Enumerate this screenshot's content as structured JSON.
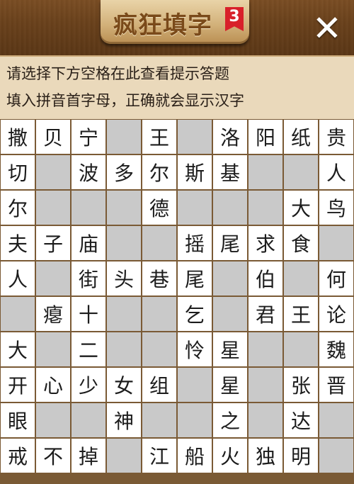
{
  "header": {
    "title": "疯狂填字",
    "level_badge": "3",
    "close_icon": "close-x-icon",
    "close_symbol": "✕"
  },
  "hints": {
    "line1": "请选择下方空格在此查看提示答题",
    "line2": "填入拼音首字母，正确就会显示汉字"
  },
  "colors": {
    "wood": "#6a411b",
    "hint_bg": "#ead9bb",
    "cell_white": "#ffffff",
    "cell_gray": "#c9c9c9",
    "badge": "#d8202a"
  },
  "grid": {
    "rows": [
      [
        "撒",
        "贝",
        "宁",
        "#",
        "王",
        "#",
        "洛",
        "阳",
        "纸",
        "贵"
      ],
      [
        "切",
        "#",
        "波",
        "多",
        "尔",
        "斯",
        "基",
        "#",
        "#",
        "人"
      ],
      [
        "尔",
        "#",
        "#",
        "#",
        "德",
        "#",
        "#",
        "#",
        "大",
        "鸟"
      ],
      [
        "夫",
        "子",
        "庙",
        "#",
        "#",
        "摇",
        "尾",
        "求",
        "食",
        "#"
      ],
      [
        "人",
        "#",
        "街",
        "头",
        "巷",
        "尾",
        "#",
        "伯",
        "#",
        "何"
      ],
      [
        "#",
        "瘪",
        "十",
        "#",
        "#",
        "乞",
        "#",
        "君",
        "王",
        "论"
      ],
      [
        "大",
        "#",
        "二",
        "#",
        "#",
        "怜",
        "星",
        "#",
        "#",
        "魏"
      ],
      [
        "开",
        "心",
        "少",
        "女",
        "组",
        "#",
        "星",
        "#",
        "张",
        "晋"
      ],
      [
        "眼",
        "#",
        "#",
        "神",
        "#",
        "#",
        "之",
        "#",
        "达",
        "#"
      ],
      [
        "戒",
        "不",
        "掉",
        "#",
        "江",
        "船",
        "火",
        "独",
        "明",
        "#"
      ]
    ]
  }
}
